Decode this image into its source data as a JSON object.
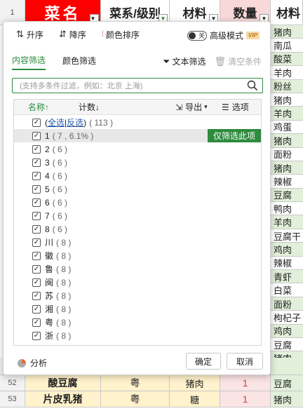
{
  "sheet": {
    "header_row_num": "1",
    "headers": {
      "b": "菜名",
      "c": "菜系/级别",
      "d": "材料",
      "e": "数量",
      "f": "材料"
    },
    "right_col": [
      "猪肉",
      "南瓜",
      "酸菜",
      "羊肉",
      "粉丝",
      "猪肉",
      "羊肉",
      "鸡蛋",
      "猪肉",
      "面粉",
      "猪肉",
      "辣椒",
      "豆腐",
      "鸭肉",
      "羊肉",
      "豆腐干",
      "鸡肉",
      "辣椒",
      "青虾",
      "白菜",
      "面粉",
      "枸杞子",
      "鸡肉",
      "豆腐",
      "猪肉"
    ],
    "bottom_rows": [
      {
        "num": "52",
        "name": "酸豆腐",
        "cuisine": "粤",
        "material": "猪肉",
        "qty": "1",
        "mat2": "豆腐"
      },
      {
        "num": "53",
        "name": "片皮乳猪",
        "cuisine": "粤",
        "material": "糖",
        "qty": "1",
        "mat2": "猪肉"
      }
    ]
  },
  "popup": {
    "sort_asc": "升序",
    "sort_desc": "降序",
    "color_sort": "颜色排序",
    "advanced_mode": "高级模式",
    "toggle_label": "关",
    "vip": "VIP",
    "tab_content": "内容筛选",
    "tab_color": "颜色筛选",
    "text_filter": "文本筛选",
    "clear_conditions": "清空条件",
    "search_placeholder": "(支持多条件过滤，例如：北京 上海)",
    "col_name": "名称↑",
    "col_count": "计数↓",
    "export": "导出",
    "options": "选项",
    "select_all": "全选",
    "invert": "反选",
    "all_count": "( 113 )",
    "only_this": "仅筛选此项",
    "items": [
      {
        "label": "1",
        "count": "( 7 , 6.1% )"
      },
      {
        "label": "2",
        "count": "( 6 )"
      },
      {
        "label": "3",
        "count": "( 6 )"
      },
      {
        "label": "4",
        "count": "( 6 )"
      },
      {
        "label": "5",
        "count": "( 6 )"
      },
      {
        "label": "6",
        "count": "( 6 )"
      },
      {
        "label": "7",
        "count": "( 6 )"
      },
      {
        "label": "8",
        "count": "( 6 )"
      },
      {
        "label": "川",
        "count": "( 8 )"
      },
      {
        "label": "徽",
        "count": "( 8 )"
      },
      {
        "label": "鲁",
        "count": "( 8 )"
      },
      {
        "label": "闽",
        "count": "( 8 )"
      },
      {
        "label": "苏",
        "count": "( 8 )"
      },
      {
        "label": "湘",
        "count": "( 8 )"
      },
      {
        "label": "粤",
        "count": "( 8 )"
      },
      {
        "label": "浙",
        "count": "( 8 )"
      }
    ],
    "analyze": "分析",
    "ok": "确定",
    "cancel": "取消"
  },
  "colors": {
    "accent": "#2e8b3e",
    "header_red": "#ff0000"
  }
}
